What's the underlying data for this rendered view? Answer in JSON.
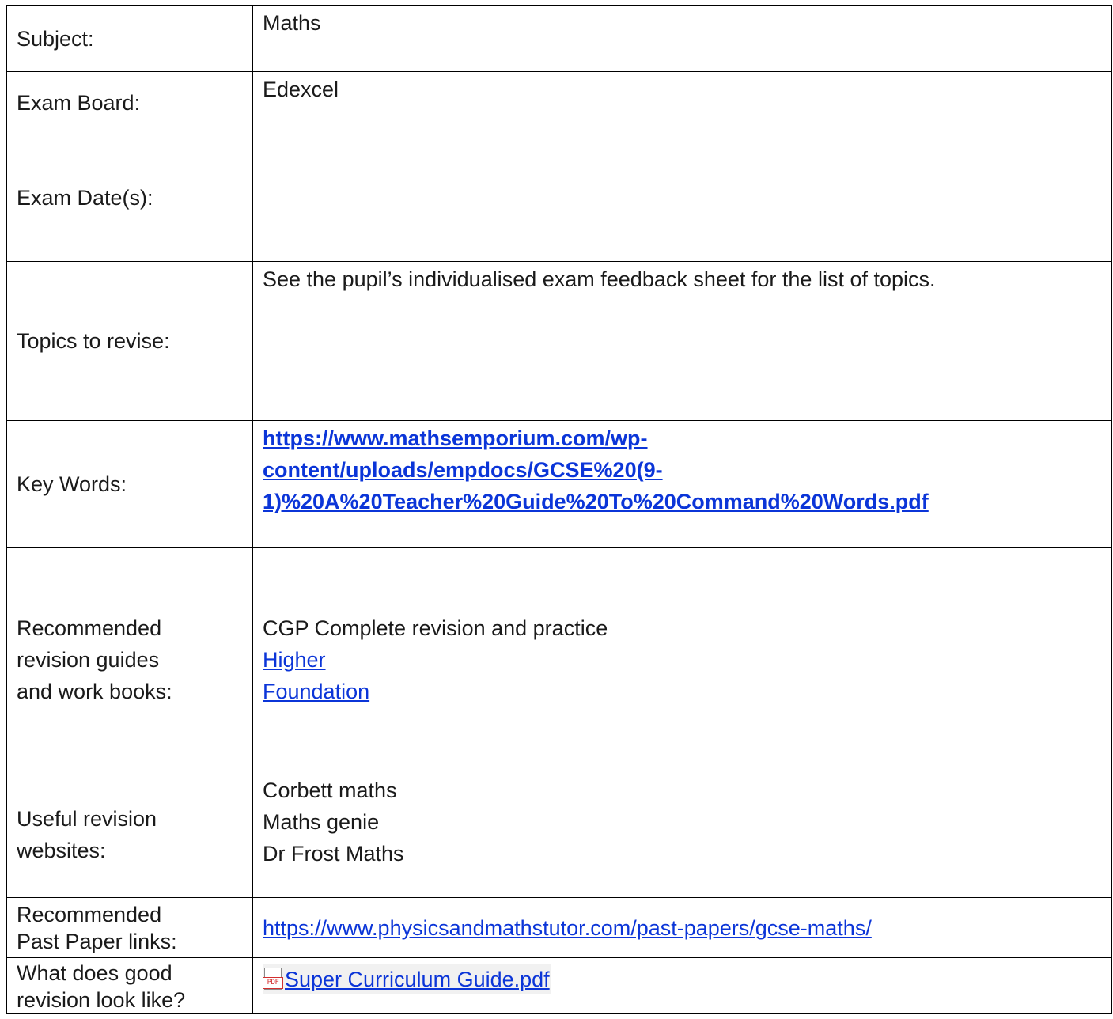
{
  "rows": {
    "subject": {
      "label": "Subject:",
      "value": "Maths"
    },
    "exam_board": {
      "label": "Exam Board:",
      "value": "Edexcel"
    },
    "exam_dates": {
      "label": "Exam Date(s):",
      "value": ""
    },
    "topics": {
      "label": "Topics to revise:",
      "value": "See the pupil’s individualised exam feedback sheet for the list of topics."
    },
    "key_words": {
      "label": "Key Words:",
      "link_lines": [
        "https://www.mathsemporium.com/wp-",
        "content/uploads/empdocs/GCSE%20(9-",
        "1)%20A%20Teacher%20Guide%20To%20Command%20Words.pdf"
      ]
    },
    "revision_guides": {
      "label_lines": [
        "Recommended",
        "revision guides",
        "and work books:"
      ],
      "intro": "CGP Complete revision and practice",
      "links": [
        "Higher",
        "Foundation"
      ]
    },
    "websites": {
      "label_lines": [
        "Useful revision",
        "websites:"
      ],
      "items": [
        "Corbett maths",
        "Maths genie",
        "Dr Frost Maths"
      ]
    },
    "past_papers": {
      "label_lines": [
        "Recommended",
        "Past Paper links:"
      ],
      "link": "https://www.physicsandmathstutor.com/past-papers/gcse-maths/"
    },
    "good_revision": {
      "label_lines": [
        "What does good",
        "revision look like?"
      ],
      "file_icon": "pdf-file-icon",
      "file_name": "Super Curriculum Guide.pdf"
    }
  },
  "colors": {
    "link": "#0b35d8",
    "border": "#000000",
    "text": "#1a1a1a"
  }
}
